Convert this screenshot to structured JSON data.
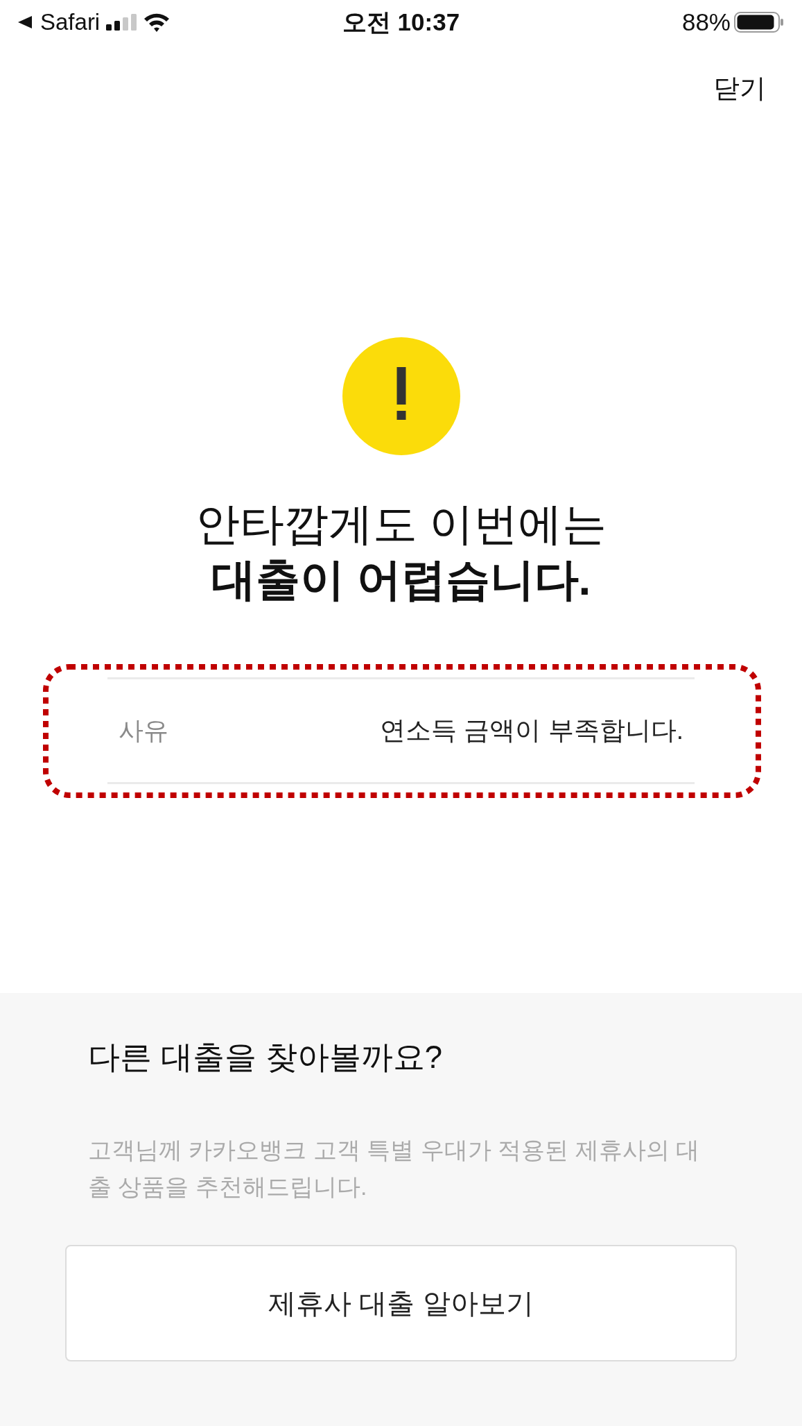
{
  "status_bar": {
    "back_app": "Safari",
    "time": "오전 10:37",
    "battery": "88%"
  },
  "header": {
    "close": "닫기"
  },
  "result": {
    "title": "안타깝게도 이번에는\n**대출이 어렵습니다.**"
  },
  "reason": {
    "label": "사유",
    "value": "연소득 금액이 부족합니다."
  },
  "suggestion": {
    "title": "다른 대출을 찾아볼까요?",
    "description": "고객님께 카카오뱅크 고객 특별 우대가 적용된 제휴사의 대출 상품을 추천해드립니다.",
    "button": "제휴사 대출 알아보기"
  }
}
